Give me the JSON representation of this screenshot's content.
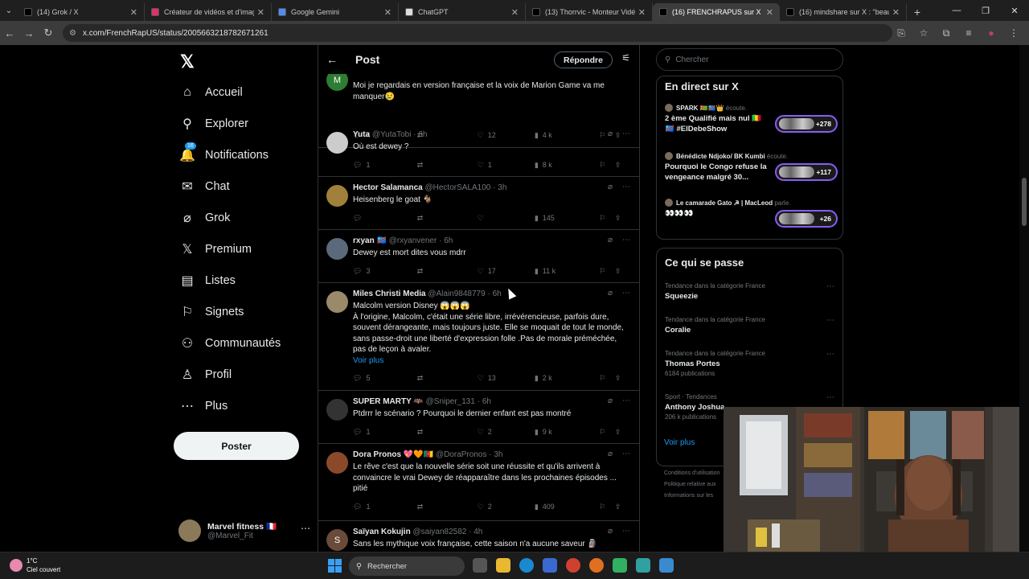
{
  "browser": {
    "tabs": [
      {
        "title": "(14) Grok / X",
        "favicon": "x-icon",
        "favcolor": "#000000"
      },
      {
        "title": "Créateur de vidéos et d'images",
        "favicon": "instagram-icon",
        "favcolor": "#e1306c"
      },
      {
        "title": "Google Gemini",
        "favicon": "gemini-icon",
        "favcolor": "#4e8df6"
      },
      {
        "title": "ChatGPT",
        "favicon": "chatgpt-icon",
        "favcolor": "#dddddd"
      },
      {
        "title": "(13) Thorrvic - Monteur Vidéo",
        "favicon": "x-icon",
        "favcolor": "#000000"
      },
      {
        "title": "(16) FRENCHRAPUS sur X : \"",
        "favicon": "x-icon",
        "favcolor": "#000000"
      },
      {
        "title": "(16) mindshare sur X : \"beauco",
        "favicon": "x-icon",
        "favcolor": "#000000"
      }
    ],
    "url": "x.com/FrenchRapUS/status/2005663218782671261"
  },
  "nav": {
    "items": [
      {
        "label": "Accueil",
        "icon": "home-icon",
        "glyph": "⌂"
      },
      {
        "label": "Explorer",
        "icon": "search-icon",
        "glyph": "⚲"
      },
      {
        "label": "Notifications",
        "icon": "bell-icon",
        "glyph": "🔔",
        "badge": "16"
      },
      {
        "label": "Chat",
        "icon": "mail-icon",
        "glyph": "✉"
      },
      {
        "label": "Grok",
        "icon": "grok-icon",
        "glyph": "⌀"
      },
      {
        "label": "Premium",
        "icon": "x-premium-icon",
        "glyph": "𝕏"
      },
      {
        "label": "Listes",
        "icon": "list-icon",
        "glyph": "▤"
      },
      {
        "label": "Signets",
        "icon": "bookmark-icon",
        "glyph": "⚐"
      },
      {
        "label": "Communautés",
        "icon": "communities-icon",
        "glyph": "⚇"
      },
      {
        "label": "Profil",
        "icon": "profile-icon",
        "glyph": "♙"
      },
      {
        "label": "Plus",
        "icon": "more-circle-icon",
        "glyph": "⋯"
      }
    ],
    "post_button": "Poster",
    "account": {
      "name": "Marvel fitness 🇫🇷",
      "handle": "@Marvel_Fit"
    }
  },
  "header": {
    "title": "Post",
    "reply_button": "Répondre"
  },
  "tweets": [
    {
      "name": "",
      "handle": "",
      "time": "",
      "avatar_color": "#2e7d32",
      "avatar_letter": "M",
      "text": "Moi je regardais en version française et la voix de Marion Game va me manquer😢",
      "more": "",
      "replies": "4",
      "retweets": "",
      "likes": "12",
      "views": "4 k"
    },
    {
      "name": "Yuta",
      "handle": "@YutaTobi",
      "time": "· 6h",
      "avatar_color": "#cccccc",
      "avatar_letter": "",
      "text": "Où est dewey ?",
      "more": "",
      "replies": "1",
      "retweets": "",
      "likes": "1",
      "views": "8 k"
    },
    {
      "name": "Hector Salamanca",
      "handle": "@HectorSALA100",
      "time": "· 3h",
      "avatar_color": "#a0803a",
      "avatar_letter": "",
      "text": "Heisenberg le goat 🐐",
      "more": "",
      "replies": "",
      "retweets": "",
      "likes": "",
      "views": "145"
    },
    {
      "name": "rxyan 🇨🇩",
      "handle": "@rxyanvener",
      "time": "· 6h",
      "avatar_color": "#5a6a7a",
      "avatar_letter": "",
      "text": "Dewey est mort dites vous mdrr",
      "more": "",
      "replies": "3",
      "retweets": "",
      "likes": "17",
      "views": "11 k"
    },
    {
      "name": "Miles Christi Media",
      "handle": "@Alain9848779",
      "time": "· 6h",
      "avatar_color": "#9a8a6a",
      "avatar_letter": "",
      "text": "Malcolm version Disney 😱😱😱\nÀ l'origine, Malcolm, c'était une série libre, irrévérencieuse, parfois dure, souvent dérangeante, mais toujours juste. Elle se moquait de tout le monde, sans passe-droit une liberté d'expression folle .Pas de morale préméchée, pas de leçon à avaler.",
      "more": "Voir plus",
      "replies": "5",
      "retweets": "",
      "likes": "13",
      "views": "2 k"
    },
    {
      "name": "SUPER MARTY 🦇",
      "handle": "@Sniper_131",
      "time": "· 6h",
      "avatar_color": "#333333",
      "avatar_letter": "",
      "text": "Ptdrrr le scénario ? Pourquoi le dernier enfant est pas montré",
      "more": "",
      "replies": "1",
      "retweets": "",
      "likes": "2",
      "views": "9 k"
    },
    {
      "name": "Dora Pronos 💖🧡🇨🇲",
      "handle": "@DoraPronos",
      "time": "· 3h",
      "avatar_color": "#8a4a2a",
      "avatar_letter": "",
      "text": "Le rêve c'est que la nouvelle série soit une réussite et qu'ils arrivent à convaincre le vrai Dewey de réapparaître dans les prochaines épisodes ... pitié",
      "more": "",
      "replies": "1",
      "retweets": "",
      "likes": "2",
      "views": "409"
    },
    {
      "name": "Saïyan Kokujin",
      "handle": "@saiyan82582",
      "time": "· 4h",
      "avatar_color": "#6a4a3a",
      "avatar_letter": "S",
      "text": "Sans les mythique voix française, cette saison n'a aucune saveur 🗿",
      "more": "",
      "replies": "",
      "retweets": "",
      "likes": "",
      "views": ""
    }
  ],
  "right": {
    "search_placeholder": "Chercher",
    "live_title": "En direct sur X",
    "live": [
      {
        "host": "SPARK 🇹🇬🇨🇩👑",
        "action": "écoute.",
        "title": "2 ème Qualifié mais nul 🇲🇱🇨🇩 #ElDebeShow",
        "count": "+278"
      },
      {
        "host": "Bénédicte Ndjoko/ BK Kumbi",
        "action": "écoute.",
        "title": "Pourquoi le Congo refuse la vengeance malgré 30...",
        "count": "+117"
      },
      {
        "host": "Le camarade Gato ☭ | MacLeod",
        "action": "parle.",
        "title": "👀👀👀",
        "count": "+26"
      }
    ],
    "trends_title": "Ce qui se passe",
    "trends": [
      {
        "category": "Tendance dans la catégorie France",
        "name": "Squeezie",
        "count": ""
      },
      {
        "category": "Tendance dans la catégorie France",
        "name": "Coralie",
        "count": ""
      },
      {
        "category": "Tendance dans la catégorie France",
        "name": "Thomas Portes",
        "count": "6184 publications"
      },
      {
        "category": "Sport · Tendances",
        "name": "Anthony Joshua",
        "count": "206 k publications"
      }
    ],
    "voir_plus": "Voir plus",
    "footer": [
      "Conditions d'utilisation",
      "Politique relative aux",
      "Informations sur les"
    ]
  },
  "taskbar": {
    "temp": "1°C",
    "weather": "Ciel couvert",
    "search": "Rechercher"
  }
}
